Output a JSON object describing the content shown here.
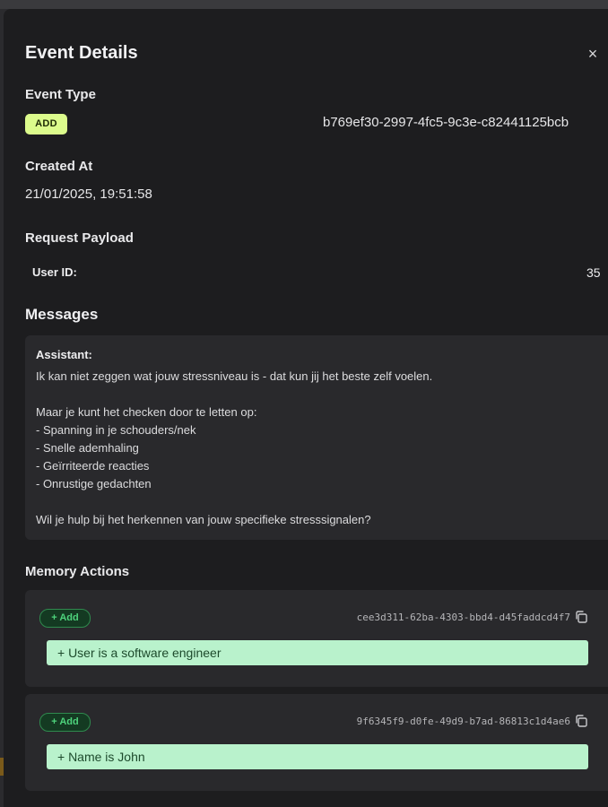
{
  "dialog": {
    "title": "Event Details",
    "close_glyph": "×"
  },
  "event_type": {
    "label": "Event Type",
    "value": "ADD",
    "id": "b769ef30-2997-4fc5-9c3e-c82441125bcb"
  },
  "created_at": {
    "label": "Created At",
    "value": "21/01/2025, 19:51:58"
  },
  "request_payload": {
    "label": "Request Payload",
    "key": "User ID:",
    "value": "35"
  },
  "messages": {
    "label": "Messages",
    "items": [
      {
        "role": "Assistant:",
        "text": "Ik kan niet zeggen wat jouw stressniveau is - dat kun jij het beste zelf voelen.\n\nMaar je kunt het checken door te letten op:\n- Spanning in je schouders/nek\n- Snelle ademhaling\n- Geïrriteerde reacties\n- Onrustige gedachten\n\nWil je hulp bij het herkennen van jouw specifieke stresssignalen?"
      }
    ]
  },
  "memory_actions": {
    "label": "Memory Actions",
    "items": [
      {
        "badge": "+ Add",
        "id": "cee3d311-62ba-4303-bbd4-d45faddcd4f7",
        "text": "+ User is a software engineer",
        "copy_icon": "copy-icon"
      },
      {
        "badge": "+ Add",
        "id": "9f6345f9-d0fe-49d9-b7ad-86813c1d4ae6",
        "text": "+ Name is John",
        "copy_icon": "copy-icon"
      }
    ]
  },
  "colors": {
    "add_badge_bg": "#dcfb8c",
    "memory_text_bg": "#b9f2cc",
    "memory_badge_fg": "#4ed37c",
    "panel_bg": "#1d1d1f"
  }
}
